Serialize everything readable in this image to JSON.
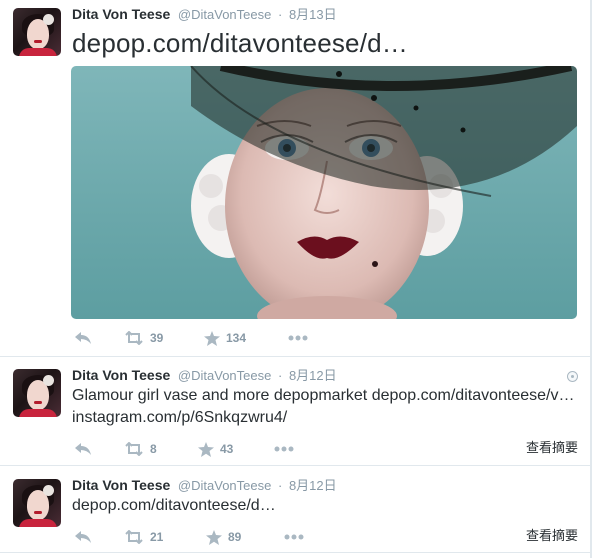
{
  "tweets": [
    {
      "fullname": "Dita Von Teese",
      "username": "@DitaVonTeese",
      "time": "8月13日",
      "text": "depop.com/ditavonteese/d…",
      "retweets": "39",
      "favorites": "134"
    },
    {
      "fullname": "Dita Von Teese",
      "username": "@DitaVonTeese",
      "time": "8月12日",
      "text_line1": "Glamour girl vase and more depopmarket depop.com/ditavonteese/v…",
      "text_line2": "instagram.com/p/6Snkqzwru4/",
      "retweets": "8",
      "favorites": "43",
      "summary": "查看摘要"
    },
    {
      "fullname": "Dita Von Teese",
      "username": "@DitaVonTeese",
      "time": "8月12日",
      "text": "depop.com/ditavonteese/d…",
      "retweets": "21",
      "favorites": "89",
      "summary": "查看摘要"
    }
  ],
  "colors": {
    "text": "#292f33",
    "muted": "#8899a6",
    "border": "#e1e8ed",
    "photo_bg": "#6aa7aa"
  },
  "icons": [
    "reply-icon",
    "retweet-icon",
    "favorite-icon",
    "more-icon",
    "caret-icon"
  ]
}
